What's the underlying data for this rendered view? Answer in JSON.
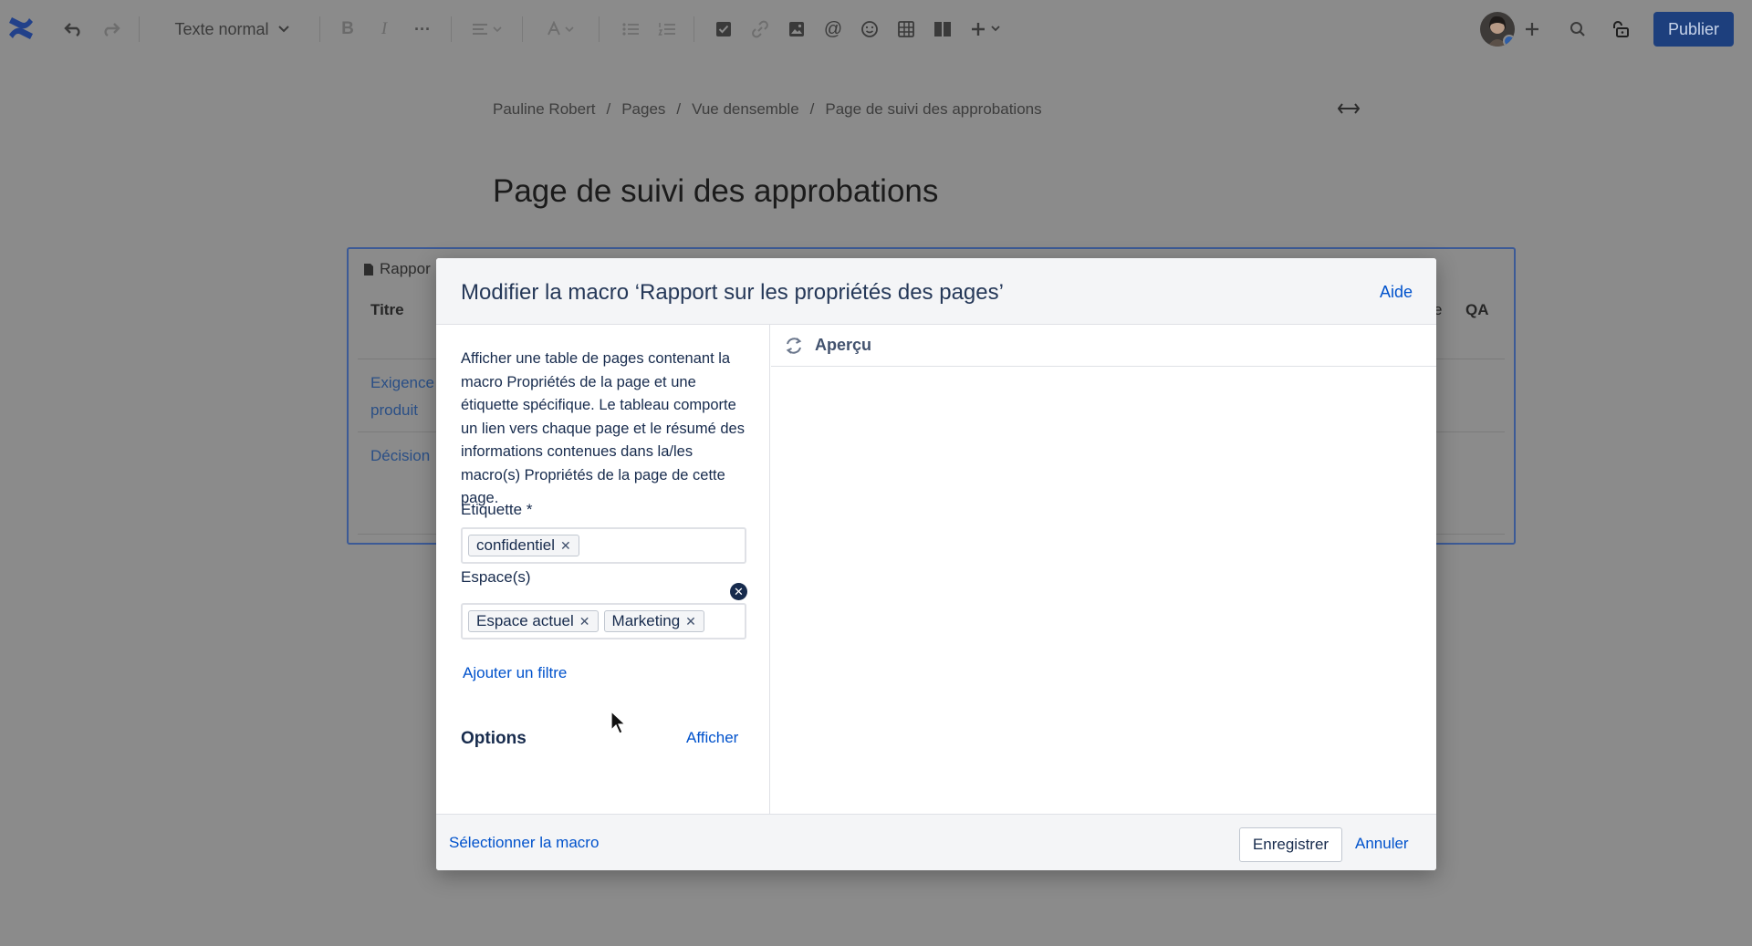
{
  "toolbar": {
    "text_style": "Texte normal",
    "icons": [
      "undo-icon",
      "redo-icon",
      "bold-icon",
      "italic-icon",
      "more-icon",
      "align-icon",
      "text-color-icon",
      "bullet-list-icon",
      "numbered-list-icon",
      "task-icon",
      "link-icon",
      "image-icon",
      "mention-icon",
      "emoji-icon",
      "table-icon",
      "layout-icon",
      "insert-icon",
      "search-icon",
      "restrictions-icon"
    ],
    "publish_label": "Publier"
  },
  "breadcrumb": {
    "items": [
      "Pauline Robert",
      "Pages",
      "Vue densemble",
      "Page de suivi des approbations"
    ],
    "separator": "/"
  },
  "page": {
    "title": "Page de suivi des approbations"
  },
  "macro_table": {
    "label": "Rappor",
    "col_title": "Titre",
    "col_qa": "QA",
    "col_partial": "e",
    "row1": "Exigence produit",
    "row2": "Décision"
  },
  "dialog": {
    "title": "Modifier la macro ‘Rapport sur les propriétés des pages’",
    "help": "Aide",
    "description": "Afficher une table de pages contenant la macro Propriétés de la page et une étiquette spécifique. Le tableau comporte un lien vers chaque page et le résumé des informations contenues dans la/les macro(s) Propriétés de la page de cette page.",
    "label_field": {
      "label": "Étiquette *",
      "tags": [
        "confidentiel"
      ]
    },
    "spaces_field": {
      "label": "Espace(s)",
      "tags": [
        "Espace actuel",
        "Marketing"
      ]
    },
    "add_filter": "Ajouter un filtre",
    "options_title": "Options",
    "options_show": "Afficher",
    "preview_label": "Aperçu",
    "select_macro": "Sélectionner la macro",
    "save": "Enregistrer",
    "cancel": "Annuler"
  },
  "colors": {
    "overlay_bg": "#8b8b8b",
    "link": "#0052cc",
    "publish_bg": "#1d3f7d",
    "text": "#172b4d"
  }
}
